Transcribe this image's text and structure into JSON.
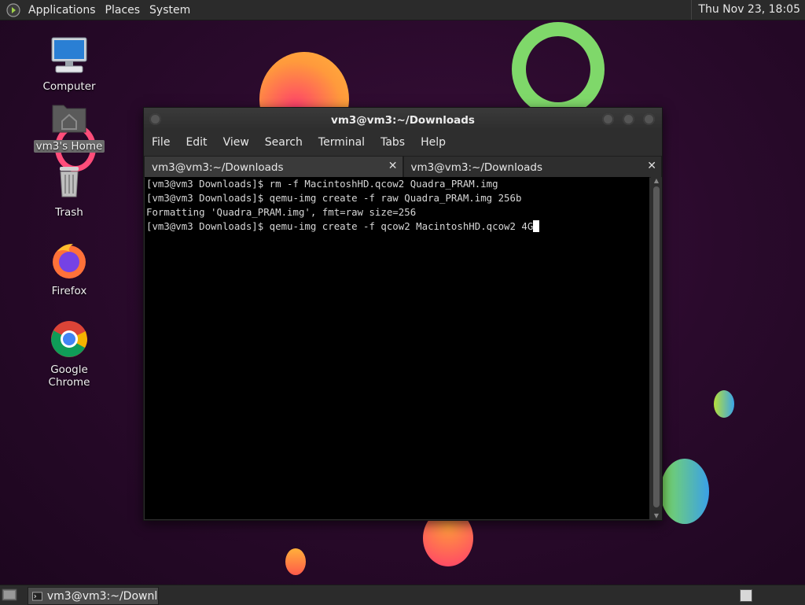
{
  "top_panel": {
    "menus": [
      "Applications",
      "Places",
      "System"
    ],
    "clock": "Thu Nov 23, 18:05"
  },
  "desktop_icons": [
    {
      "label": "Computer",
      "icon": "computer-icon"
    },
    {
      "label": "vm3's Home",
      "icon": "home-folder-icon"
    },
    {
      "label": "Trash",
      "icon": "trash-icon"
    },
    {
      "label": "Firefox",
      "icon": "firefox-icon"
    },
    {
      "label": "Google Chrome",
      "icon": "chrome-icon"
    }
  ],
  "terminal": {
    "title": "vm3@vm3:~/Downloads",
    "menu": [
      "File",
      "Edit",
      "View",
      "Search",
      "Terminal",
      "Tabs",
      "Help"
    ],
    "tabs": [
      {
        "label": "vm3@vm3:~/Downloads",
        "active": false
      },
      {
        "label": "vm3@vm3:~/Downloads",
        "active": true
      }
    ],
    "lines": [
      "[vm3@vm3 Downloads]$ rm -f MacintoshHD.qcow2 Quadra_PRAM.img",
      "[vm3@vm3 Downloads]$ qemu-img create -f raw Quadra_PRAM.img 256b",
      "Formatting 'Quadra_PRAM.img', fmt=raw size=256",
      "[vm3@vm3 Downloads]$ qemu-img create -f qcow2 MacintoshHD.qcow2 4G"
    ]
  },
  "taskbar": {
    "window_label": "vm3@vm3:~/Downl..."
  },
  "colors": {
    "panel": "#2b2b2b",
    "terminal_bg": "#000000",
    "terminal_fg": "#d6d6d6",
    "desktop_bg": "#2a0a2c"
  }
}
